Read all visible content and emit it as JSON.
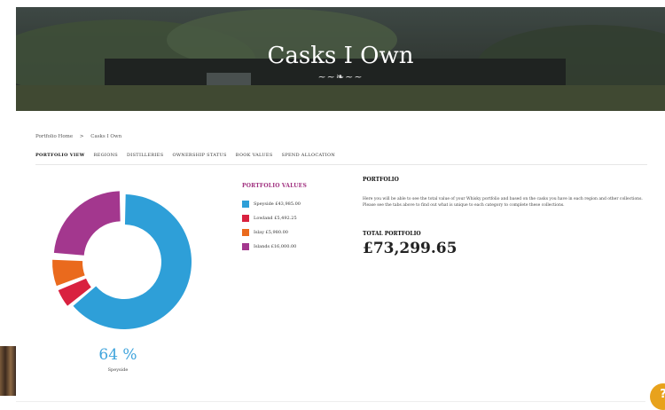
{
  "hero": {
    "title": "Casks I Own",
    "ornament": "~~❧~~"
  },
  "breadcrumb": [
    "Portfolio Home",
    ">",
    "Casks I Own"
  ],
  "tabs": [
    {
      "label": "Portfolio View",
      "active": true
    },
    {
      "label": "Regions",
      "active": false
    },
    {
      "label": "Distilleries",
      "active": false
    },
    {
      "label": "Ownership Status",
      "active": false
    },
    {
      "label": "Book Values",
      "active": false
    },
    {
      "label": "Spend Allocation",
      "active": false
    }
  ],
  "portfolio_values": {
    "title": "PORTFOLIO VALUES",
    "items": [
      {
        "label": "Speyside £43,985.00",
        "color": "#2e9fd8",
        "share": 0.64
      },
      {
        "label": "Lowland £5,492.25",
        "color": "#d9213f",
        "share": 0.05
      },
      {
        "label": "Islay £5,980.00",
        "color": "#ea6a1d",
        "share": 0.07
      },
      {
        "label": "Islands £16,000.00",
        "color": "#a3378e",
        "share": 0.24
      }
    ]
  },
  "highlight": {
    "percent": "64 %",
    "label": "Speyside"
  },
  "portfolio": {
    "title": "PORTFOLIO",
    "description": "Here you will be able to see the total value of your Whisky portfolio and based on the casks you have in each region and other collections. Please see the tabs above to find out what is unique to each category to complete these collections.",
    "total_label": "TOTAL PORTFOLIO",
    "total_value": "£73,299.65"
  },
  "help": {
    "icon": "help-icon",
    "glyph": "?"
  }
}
